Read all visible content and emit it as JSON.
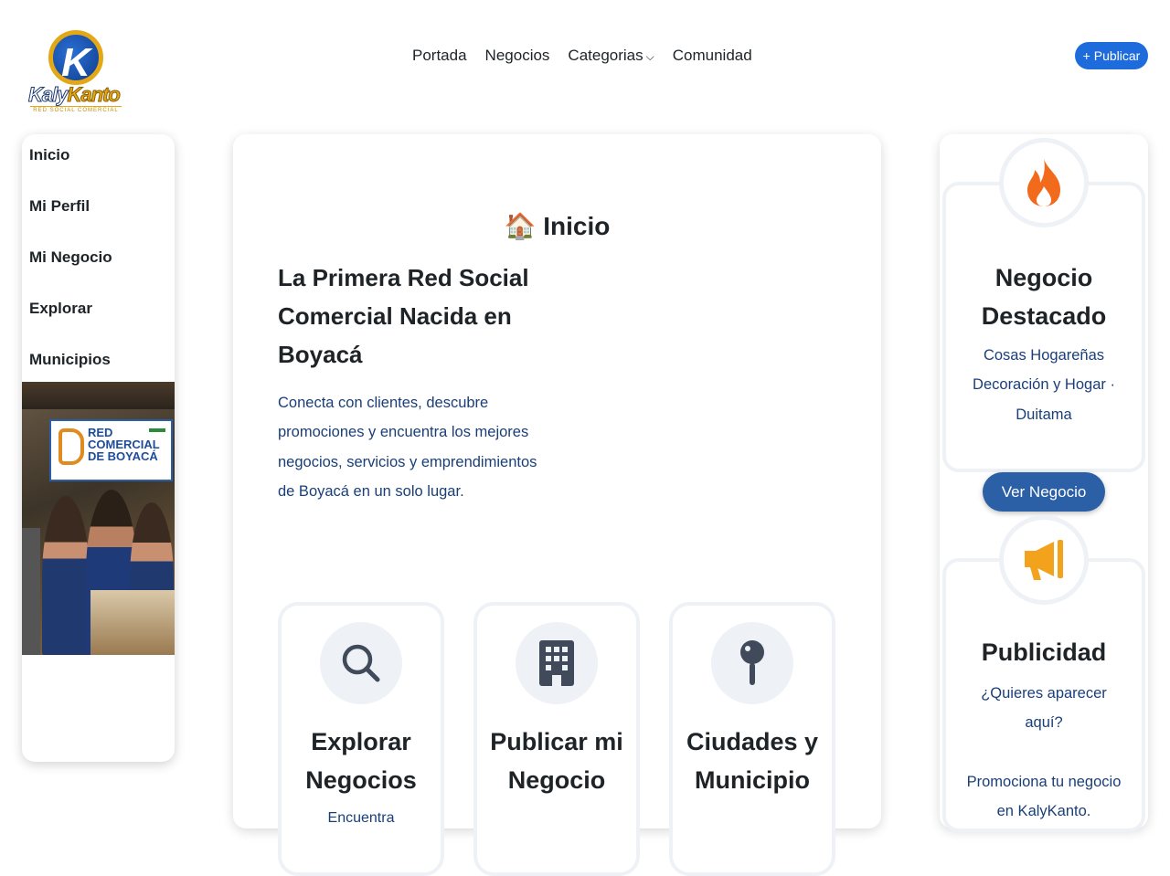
{
  "header": {
    "logo_text_1": "Kaly",
    "logo_text_2": "Kanto",
    "logo_tagline": "RED SOCIAL COMERCIAL",
    "nav": [
      "Portada",
      "Negocios",
      "Categorias",
      "Comunidad"
    ],
    "publish_label": "+ Publicar"
  },
  "sidebar": {
    "items": [
      {
        "label": "Inicio"
      },
      {
        "label": "Mi Perfil"
      },
      {
        "label": "Mi Negocio"
      },
      {
        "label": "Explorar"
      },
      {
        "label": "Municipios"
      }
    ],
    "banner_text": "RED COMERCIAL DE BOYACÁ"
  },
  "main": {
    "page_icon": "🏠",
    "page_title": "Inicio",
    "hero_title": "La Primera Red Social Comercial Nacida en Boyacá",
    "hero_text": "Conecta con clientes, descubre promociones y encuentra los mejores negocios, servicios y emprendimientos de Boyacá en un solo lugar.",
    "features": [
      {
        "title": "Explorar Negocios",
        "desc": "Encuentra",
        "icon": "search-icon"
      },
      {
        "title": "Publicar mi Negocio",
        "desc": "",
        "icon": "building-icon"
      },
      {
        "title": "Ciudades y Municipio",
        "desc": "",
        "icon": "map-pin-icon"
      }
    ]
  },
  "right": {
    "featured": {
      "title": "Negocio Destacado",
      "text": "Cosas Hogareñas Decoración y Hogar · Duitama",
      "button": "Ver Negocio",
      "icon": "fire-icon"
    },
    "ads": {
      "title": "Publicidad",
      "text_1": "¿Quieres aparecer aquí?",
      "text_2": "Promociona tu negocio en KalyKanto.",
      "icon": "megaphone-icon"
    }
  },
  "colors": {
    "accent": "#1e6bdc",
    "button_blue": "#2b5fa6",
    "text_blue": "#1a3f78",
    "fire": "#f26a1b",
    "megaphone": "#f2a21b"
  }
}
